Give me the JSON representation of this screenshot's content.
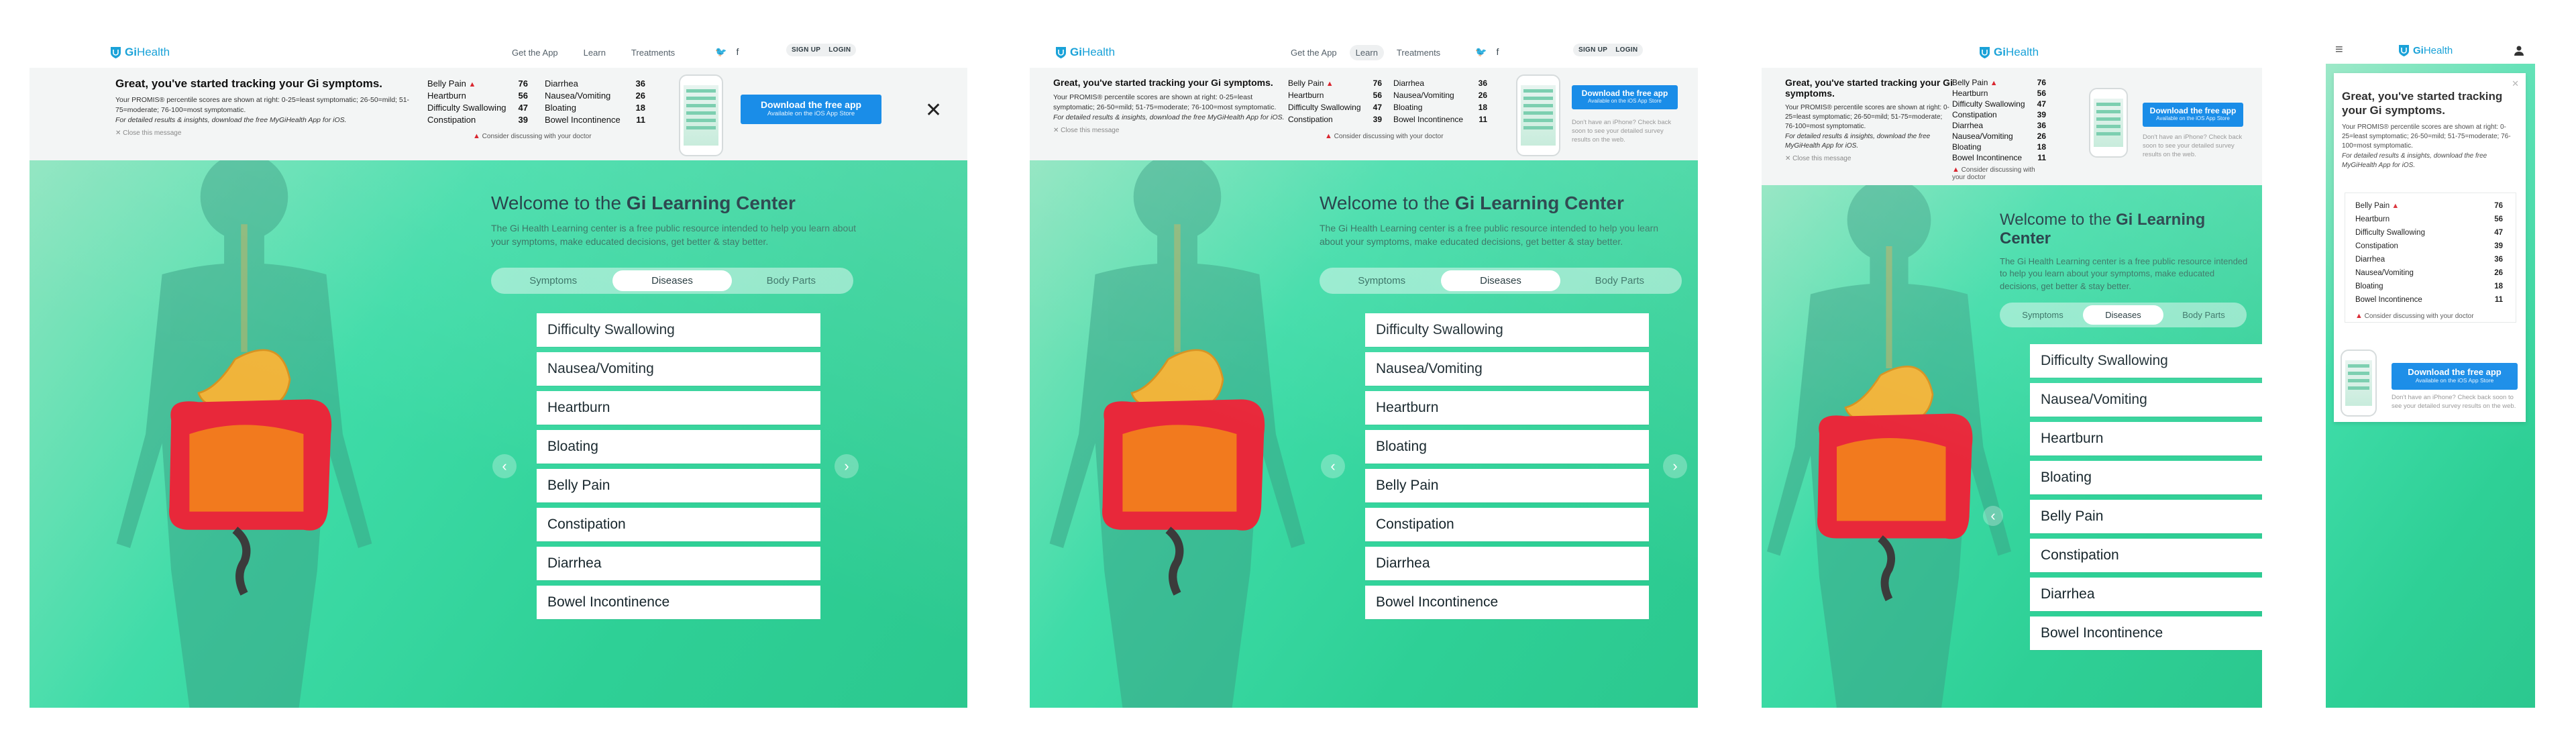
{
  "brand": {
    "name": "GiHealth",
    "name_prefix": "Gi",
    "name_suffix": "Health"
  },
  "nav": {
    "get_app": "Get the App",
    "learn": "Learn",
    "treatments": "Treatments",
    "twitter_glyph": "🐦",
    "facebook_glyph": "f",
    "signup": "SIGN UP",
    "login": "LOGIN"
  },
  "banner": {
    "title": "Great, you've started tracking your Gi symptoms.",
    "body_line": "Your PROMIS® percentile scores are shown at right: 0-25=least symptomatic; 26-50=mild; 51-75=moderate; 76-100=most symptomatic.",
    "body_italic": "For detailed results & insights, download the free MyGiHealth App for iOS.",
    "close_link": "✕  Close this message",
    "consider": "Consider discussing with your doctor",
    "download_title": "Download the free app",
    "download_sub": "Available on the iOS App Store",
    "iphone_note": "Don't have an iPhone? Check back soon to see your detailed survey results on the web.",
    "warn_glyph": "▲",
    "close_x": "✕",
    "scores_left": [
      {
        "label": "Belly Pain",
        "value": "76",
        "flag": true
      },
      {
        "label": "Heartburn",
        "value": "56",
        "flag": false
      },
      {
        "label": "Difficulty Swallowing",
        "value": "47",
        "flag": false
      },
      {
        "label": "Constipation",
        "value": "39",
        "flag": false
      }
    ],
    "scores_right": [
      {
        "label": "Diarrhea",
        "value": "36"
      },
      {
        "label": "Nausea/Vomiting",
        "value": "26"
      },
      {
        "label": "Bloating",
        "value": "18"
      },
      {
        "label": "Bowel Incontinence",
        "value": "11"
      }
    ]
  },
  "hero": {
    "welcome_prefix": "Welcome to the ",
    "welcome_bold": "Gi Learning Center",
    "intro": "The Gi Health Learning center is a free public resource intended to help you learn about your symptoms, make educated decisions, get better & stay better.",
    "tabs": [
      "Symptoms",
      "Diseases",
      "Body Parts"
    ],
    "active_tab": "Diseases",
    "items": [
      "Difficulty Swallowing",
      "Nausea/Vomiting",
      "Heartburn",
      "Bloating",
      "Belly Pain",
      "Constipation",
      "Diarrhea",
      "Bowel Incontinence"
    ],
    "prev_arrow": "‹",
    "next_arrow": "›"
  },
  "mobile": {
    "menu_icon": "≡",
    "scores": [
      {
        "label": "Belly Pain",
        "value": "76",
        "flag": true
      },
      {
        "label": "Heartburn",
        "value": "56",
        "flag": false
      },
      {
        "label": "Difficulty Swallowing",
        "value": "47",
        "flag": false
      },
      {
        "label": "Constipation",
        "value": "39",
        "flag": false
      },
      {
        "label": "Diarrhea",
        "value": "36",
        "flag": false
      },
      {
        "label": "Nausea/Vomiting",
        "value": "26",
        "flag": false
      },
      {
        "label": "Bloating",
        "value": "18",
        "flag": false
      },
      {
        "label": "Bowel Incontinence",
        "value": "11",
        "flag": false
      }
    ]
  },
  "colors": {
    "brand_blue": "#1aa2d8",
    "download_blue": "#1a8de8",
    "hero_green": "#2ed096",
    "warn_red": "#d9262f"
  }
}
